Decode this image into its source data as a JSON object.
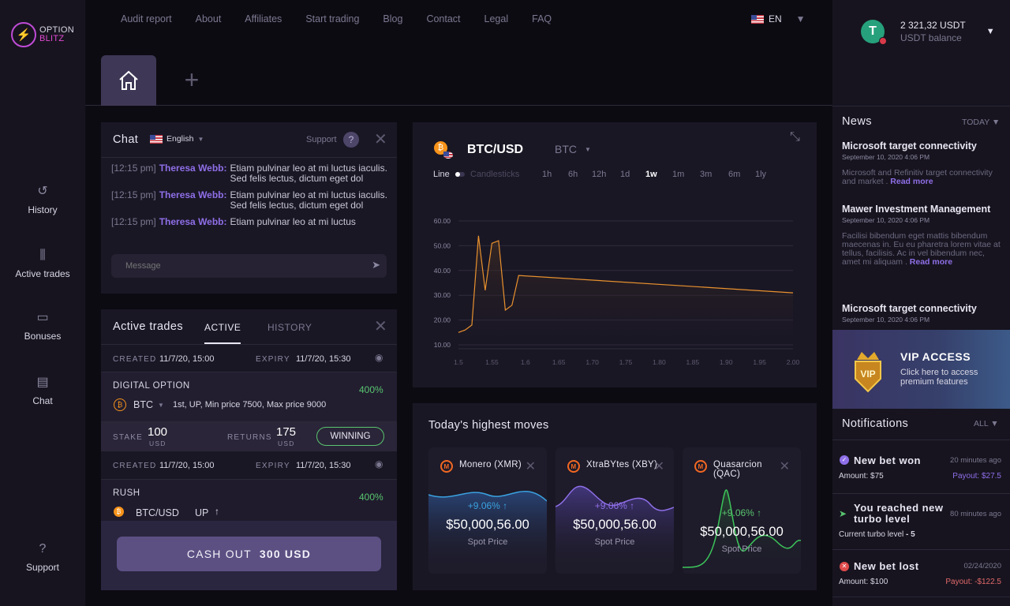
{
  "brand": {
    "top": "OPTION",
    "bottom": "BLITZ"
  },
  "sidebar": [
    {
      "label": "History",
      "icon": "history-icon"
    },
    {
      "label": "Active trades",
      "icon": "active-trades-icon"
    },
    {
      "label": "Bonuses",
      "icon": "bonuses-icon"
    },
    {
      "label": "Chat",
      "icon": "chat-icon"
    },
    {
      "label": "Support",
      "icon": "support-icon"
    }
  ],
  "nav": [
    "Audit report",
    "About",
    "Affiliates",
    "Start trading",
    "Blog",
    "Contact",
    "Legal",
    "FAQ"
  ],
  "lang": "EN",
  "balance": {
    "amount": "2 321,32 USDT",
    "label": "USDT balance"
  },
  "chat": {
    "title": "Chat",
    "language": "English",
    "support": "Support",
    "messages": [
      {
        "time": "[12:15 pm]",
        "user": "Theresa Webb:",
        "text": "Etiam pulvinar leo at mi luctus iaculis. Sed felis lectus, dictum eget dol"
      },
      {
        "time": "[12:15 pm]",
        "user": "Theresa Webb:",
        "text": "Etiam pulvinar leo at mi luctus iaculis. Sed felis lectus, dictum eget dol"
      },
      {
        "time": "[12:15 pm]",
        "user": "Theresa Webb:",
        "text": "Etiam pulvinar leo at mi luctus"
      }
    ],
    "placeholder": "Message"
  },
  "trades": {
    "title": "Active trades",
    "tab_active": "ACTIVE",
    "tab_history": "HISTORY",
    "created_label": "CREATED",
    "expiry_label": "EXPIRY",
    "t1": {
      "created": "11/7/20, 15:00",
      "expiry": "11/7/20, 15:30",
      "type": "DIGITAL OPTION",
      "pct": "400%",
      "asset": "BTC",
      "desc": "1st, UP, Min price 7500, Max price 9000",
      "stake_label": "STAKE",
      "stake": "100",
      "stake_unit": "USD",
      "returns_label": "RETURNS",
      "returns": "175",
      "returns_unit": "USD",
      "status": "WINNING"
    },
    "t2": {
      "created": "11/7/20, 15:00",
      "expiry": "11/7/20, 15:30",
      "type": "RUSH",
      "pct": "400%",
      "asset": "BTC/USD",
      "dir": "UP"
    },
    "cashout_label": "CASH OUT",
    "cashout_amount": "300 USD"
  },
  "chart": {
    "pair": "BTC/USD",
    "asset": "BTC",
    "modes": {
      "line": "Line",
      "candles": "Candlesticks"
    },
    "ranges": [
      "1h",
      "6h",
      "12h",
      "1d",
      "1w",
      "1m",
      "3m",
      "6m",
      "1ly"
    ],
    "selected_range": "1w"
  },
  "chart_data": {
    "type": "line",
    "series": [
      {
        "values": [
          [
            1.5,
            15
          ],
          [
            1.51,
            16
          ],
          [
            1.52,
            18
          ],
          [
            1.53,
            54
          ],
          [
            1.54,
            32
          ],
          [
            1.55,
            51
          ],
          [
            1.56,
            52
          ],
          [
            1.57,
            24
          ],
          [
            1.58,
            26
          ],
          [
            1.59,
            38
          ],
          [
            2.0,
            31
          ]
        ]
      }
    ],
    "xticks": [
      "1.5",
      "1.55",
      "1.6",
      "1.65",
      "1.70",
      "1.75",
      "1.80",
      "1.85",
      "1.90",
      "1.95",
      "2.00"
    ],
    "yticks": [
      "60.00",
      "50.00",
      "40.00",
      "30.00",
      "20.00",
      "10.00"
    ],
    "xlim": [
      1.5,
      2.0
    ],
    "ylim": [
      10,
      60
    ],
    "grid": true
  },
  "moves": {
    "title": "Today's highest moves",
    "cards": [
      {
        "name": "Monero (XMR)",
        "pct": "+9.06%",
        "price": "$50,000,56.00",
        "sub": "Spot Price"
      },
      {
        "name": "XtraBYtes (XBY)",
        "pct": "+9.06%",
        "price": "$50,000,56.00",
        "sub": "Spot Price"
      },
      {
        "name": "Quasarcion (QAC)",
        "pct": "+9.06%",
        "price": "$50,000,56.00",
        "sub": "Spot Price"
      }
    ]
  },
  "news": {
    "title": "News",
    "filter": "TODAY",
    "items": [
      {
        "title": "Microsoft target connectivity",
        "date": "September 10, 2020 4:06 PM",
        "body": "Microsoft and Refinitiv target connectivity and market .",
        "more": "Read more"
      },
      {
        "title": "Mawer Investment Management",
        "date": "September 10, 2020 4:06 PM",
        "body": "Facilisi bibendum eget mattis bibendum maecenas in. Eu eu pharetra lorem vitae at tellus, facilisis. Ac in vel bibendum nec, amet mi aliquam .",
        "more": "Read more"
      },
      {
        "title": "Microsoft target connectivity",
        "date": "September 10, 2020 4:06 PM"
      }
    ]
  },
  "vip": {
    "title": "VIP ACCESS",
    "text": "Click here to access premium features",
    "badge": "VIP"
  },
  "notifications": {
    "title": "Notifications",
    "filter": "ALL",
    "items": [
      {
        "title": "New bet won",
        "time": "20 minutes ago",
        "amount": "Amount: $75",
        "payout": "Payout: $27.5"
      },
      {
        "title": "You reached new turbo level",
        "time": "80 minutes ago",
        "detail_label": "Current turbo level",
        "detail_value": "- 5"
      },
      {
        "title": "New bet lost",
        "time": "02/24/2020",
        "amount": "Amount: $100",
        "payout": "Payout: -$122.5"
      }
    ]
  }
}
